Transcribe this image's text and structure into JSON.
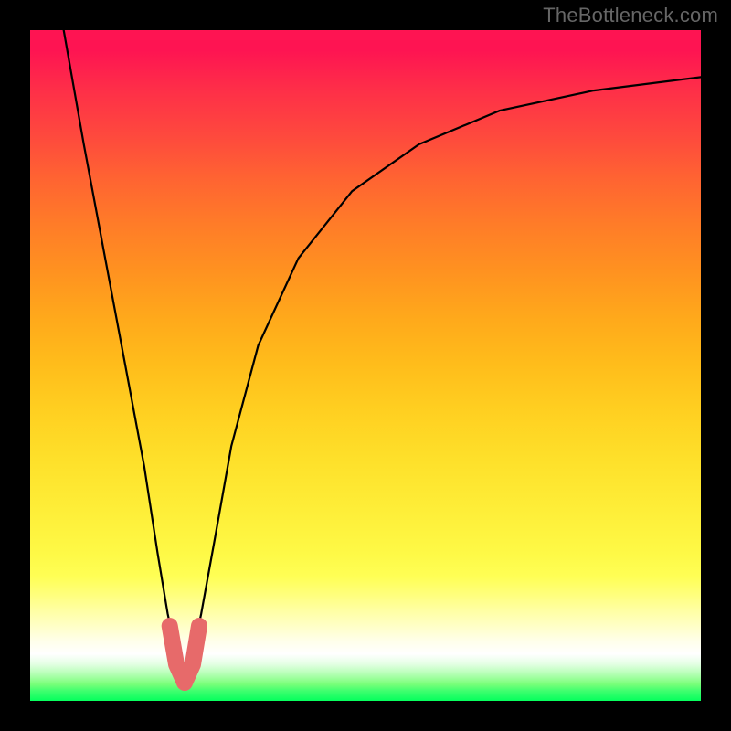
{
  "watermark": {
    "text": "TheBottleneck.com"
  },
  "colors": {
    "frame_bg_top": "#fe1452",
    "frame_bg_bottom": "#05ff5d",
    "curve": "#000000",
    "highlight": "#e76a6a",
    "page_bg": "#000000",
    "watermark": "#666666"
  },
  "chart_data": {
    "type": "line",
    "title": "",
    "xlabel": "",
    "ylabel": "",
    "xlim": [
      0,
      100
    ],
    "ylim": [
      0,
      100
    ],
    "notes": "V-shaped bottleneck curve; y = 100 at margins, dips to ~3 near x≈23, pink segment marks the trough",
    "series": [
      {
        "name": "bottleneck-curve",
        "x": [
          5,
          8,
          11,
          14,
          17,
          19,
          20.5,
          22,
          23,
          24,
          25.5,
          27.5,
          30,
          34,
          40,
          48,
          58,
          70,
          84,
          100
        ],
        "y": [
          100,
          83,
          67,
          51,
          35,
          22,
          13,
          6,
          3,
          6,
          13,
          24,
          38,
          53,
          66,
          76,
          83,
          88,
          91,
          93
        ]
      }
    ],
    "highlight_range_x": [
      20.8,
      25.2
    ]
  }
}
